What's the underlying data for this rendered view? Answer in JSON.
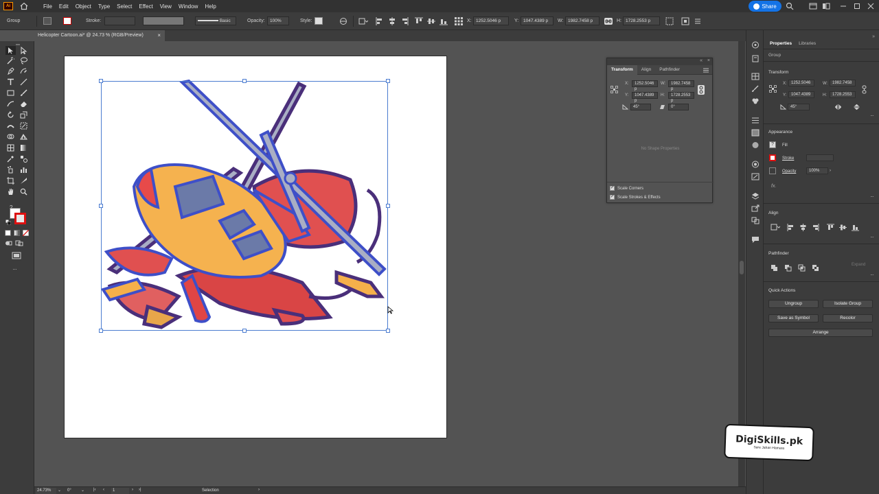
{
  "menubar": {
    "app_logo": "Ai",
    "items": [
      "File",
      "Edit",
      "Object",
      "Type",
      "Select",
      "Effect",
      "View",
      "Window",
      "Help"
    ],
    "share_label": "Share"
  },
  "control_bar": {
    "selection_type": "Group",
    "stroke_label": "Stroke:",
    "brush_label": "Basic",
    "opacity_label": "Opacity:",
    "opacity_value": "100%",
    "style_label": "Style:",
    "x_label": "X:",
    "x_value": "1252.5046 p",
    "y_label": "Y:",
    "y_value": "1047.4389 p",
    "w_label": "W:",
    "w_value": "1982.7458 p",
    "h_label": "H:",
    "h_value": "1728.2553 p"
  },
  "document_tab": {
    "title": "Helicopter Cartoon.ai* @ 24.73 % (RGB/Preview)",
    "close": "×"
  },
  "transform_panel": {
    "tabs": [
      "Transform",
      "Align",
      "Pathfinder"
    ],
    "x_label": "X:",
    "x_value": "1252.5046 p",
    "y_label": "Y:",
    "y_value": "1047.4389 p",
    "w_label": "W:",
    "w_value": "1982.7458 p",
    "h_label": "H:",
    "h_value": "1728.2553 p",
    "rotate_value": "45°",
    "shear_value": "0°",
    "no_shape": "No Shape Properties",
    "scale_corners": "Scale Corners",
    "scale_strokes": "Scale Strokes & Effects"
  },
  "properties_panel": {
    "tabs": [
      "Properties",
      "Libraries"
    ],
    "selection": "Group",
    "transform_title": "Transform",
    "x_value": "1252.5046",
    "w_value": "1982.7458",
    "y_value": "1047.4389",
    "h_value": "1728.2553",
    "x_label": "X:",
    "y_label": "Y:",
    "w_label": "W:",
    "h_label": "H:",
    "rotate_value": "45°",
    "appearance_title": "Appearance",
    "fill_label": "Fill",
    "stroke_label": "Stroke",
    "opacity_label": "Opacity",
    "opacity_value": "100%",
    "fx_label": "fx.",
    "align_title": "Align",
    "pathfinder_title": "Pathfinder",
    "expand_label": "Expand",
    "quick_actions_title": "Quick Actions",
    "btn_ungroup": "Ungroup",
    "btn_isolate": "Isolate Group",
    "btn_save_symbol": "Save as Symbol",
    "btn_recolor": "Recolor",
    "btn_arrange": "Arrange"
  },
  "statusbar": {
    "zoom": "24.73%",
    "rotation": "0°",
    "artboard": "1",
    "tool": "Selection"
  },
  "watermark": {
    "brand": "DigiSkills.pk",
    "tagline": "Sare Jahan Hamara"
  },
  "colors": {
    "accent": "#1473e6",
    "selection": "#4a7bd0",
    "panel_bg": "#3c3c3c",
    "workspace": "#535353"
  }
}
